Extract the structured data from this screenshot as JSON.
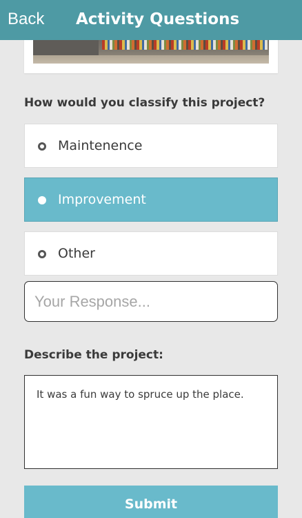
{
  "navbar": {
    "back_label": "Back",
    "title": "Activity Questions"
  },
  "header_image": {
    "icon": "project-photo"
  },
  "question1": {
    "label": "How would you classify this project?",
    "options": [
      {
        "label": "Maintenence",
        "selected": false
      },
      {
        "label": "Improvement",
        "selected": true
      },
      {
        "label": "Other",
        "selected": false
      }
    ],
    "response_placeholder": "Your Response...",
    "response_value": ""
  },
  "question2": {
    "label": "Describe the project:",
    "answer": "It was a fun way to spruce up the place."
  },
  "submit_label": "Submit",
  "colors": {
    "navbar": "#4e9aa4",
    "accent": "#69bacb",
    "background": "#e8e8e8"
  }
}
